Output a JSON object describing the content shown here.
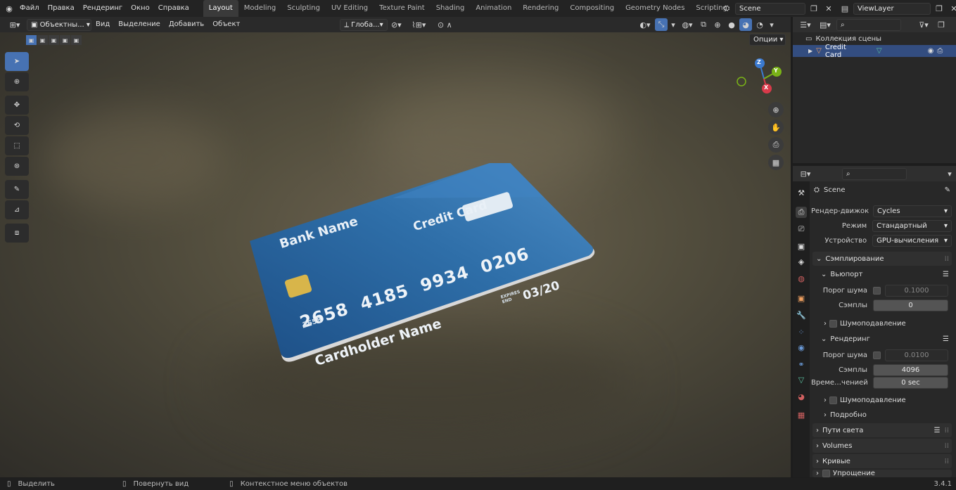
{
  "topbar": {
    "menus": [
      "Файл",
      "Правка",
      "Рендеринг",
      "Окно",
      "Справка"
    ],
    "workspaces": [
      "Layout",
      "Modeling",
      "Sculpting",
      "UV Editing",
      "Texture Paint",
      "Shading",
      "Animation",
      "Rendering",
      "Compositing",
      "Geometry Nodes",
      "Scripting"
    ],
    "add_workspace": "+",
    "scene_name": "Scene",
    "view_layer": "ViewLayer"
  },
  "viewport_header": {
    "mode": "Объектны...",
    "menus": [
      "Вид",
      "Выделение",
      "Добавить",
      "Объект"
    ],
    "orientation": "Глоба...",
    "options": "Опции"
  },
  "card": {
    "bank_name": "Bank Name",
    "title": "Credit Card",
    "number": "2658  4185  9934  0206",
    "small_number": "2658",
    "expires_label": "EXPIRES END",
    "expiry": "03/20",
    "holder": "Cardholder Name",
    "colors": {
      "base": "#2e6ea8",
      "dark": "#1d4f86",
      "light": "#4b8cc6"
    }
  },
  "gizmo": {
    "z": "Z",
    "y": "Y",
    "x": "X"
  },
  "outliner": {
    "collection": "Коллекция сцены",
    "object": "Credit Card"
  },
  "properties": {
    "scene_label": "Scene",
    "render_engine_label": "Рендер-движок",
    "render_engine_value": "Cycles",
    "mode_label": "Режим",
    "mode_value": "Стандартный",
    "device_label": "Устройство",
    "device_value": "GPU-вычисления",
    "sampling_header": "Сэмплирование",
    "viewport_header": "Вьюпорт",
    "noise_threshold_label": "Порог шума",
    "vp_noise_value": "0.1000",
    "samples_label": "Сэмплы",
    "vp_samples_value": "0",
    "denoise_label": "Шумоподавление",
    "render_header": "Рендеринг",
    "r_noise_value": "0.0100",
    "r_samples_value": "4096",
    "time_limit_label": "Време…ченией",
    "time_limit_value": "0 sec",
    "r_denoise_label": "Шумоподавление",
    "advanced_label": "Подробно",
    "light_paths": "Пути света",
    "volumes": "Volumes",
    "curves": "Кривые",
    "simplify": "Упрощение"
  },
  "statusbar": {
    "select": "Выделить",
    "rotate": "Повернуть вид",
    "context": "Контекстное меню объектов",
    "version": "3.4.1"
  },
  "accent": "#4772b3"
}
